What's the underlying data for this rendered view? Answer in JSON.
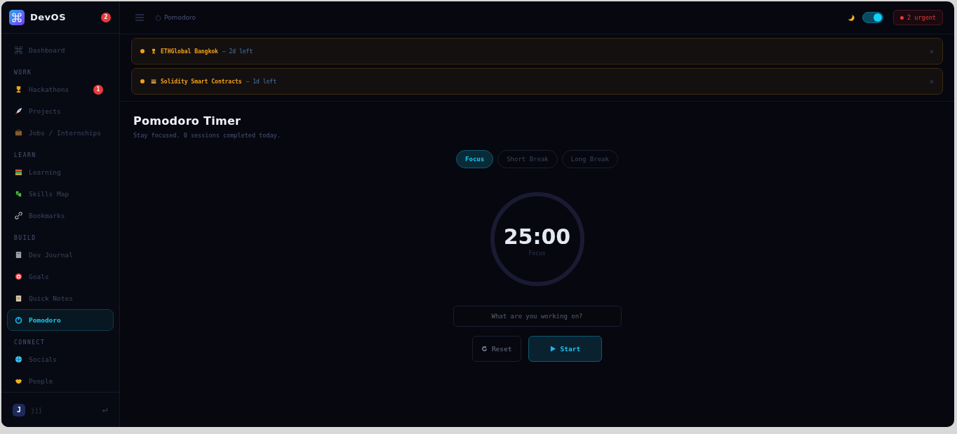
{
  "brand": {
    "name": "DevOS",
    "badge": "2"
  },
  "sidebar": {
    "sections": [
      {
        "items": [
          {
            "label": "Dashboard",
            "selected": false
          }
        ]
      },
      {
        "title": "WORK",
        "items": [
          {
            "label": "Hackathons",
            "selected": false,
            "badge": "1"
          },
          {
            "label": "Projects",
            "selected": false
          },
          {
            "label": "Jobs / Internships",
            "selected": false
          }
        ]
      },
      {
        "title": "LEARN",
        "items": [
          {
            "label": "Learning",
            "selected": false
          },
          {
            "label": "Skills Map",
            "selected": false
          },
          {
            "label": "Bookmarks",
            "selected": false
          }
        ]
      },
      {
        "title": "BUILD",
        "items": [
          {
            "label": "Dev Journal",
            "selected": false
          },
          {
            "label": "Goals",
            "selected": false
          },
          {
            "label": "Quick Notes",
            "selected": false
          },
          {
            "label": "Pomodoro",
            "selected": true
          }
        ]
      },
      {
        "title": "CONNECT",
        "items": [
          {
            "label": "Socials",
            "selected": false
          },
          {
            "label": "People",
            "selected": false
          }
        ]
      }
    ],
    "user": {
      "initial": "J",
      "name": "jjj"
    }
  },
  "header": {
    "breadcrumb": "Pomodoro",
    "dark_mode": true,
    "urgent": "2 urgent"
  },
  "alerts": [
    {
      "title": "ETHGlobal Bangkok",
      "remaining": "— 2d left",
      "close": "×"
    },
    {
      "title": "Solidity Smart Contracts",
      "remaining": "— 1d left",
      "close": "×"
    }
  ],
  "page": {
    "title": "Pomodoro Timer",
    "subtitle": "Stay focused. 0 sessions completed today."
  },
  "modes": [
    {
      "label": "Focus",
      "selected": true
    },
    {
      "label": "Short Break",
      "selected": false
    },
    {
      "label": "Long Break",
      "selected": false
    }
  ],
  "timer": {
    "time": "25:00",
    "label": "Focus"
  },
  "task": {
    "placeholder": "What are you working on?"
  },
  "actions": [
    {
      "kind": "reset",
      "label": "Reset"
    },
    {
      "kind": "start",
      "label": "Start"
    }
  ]
}
